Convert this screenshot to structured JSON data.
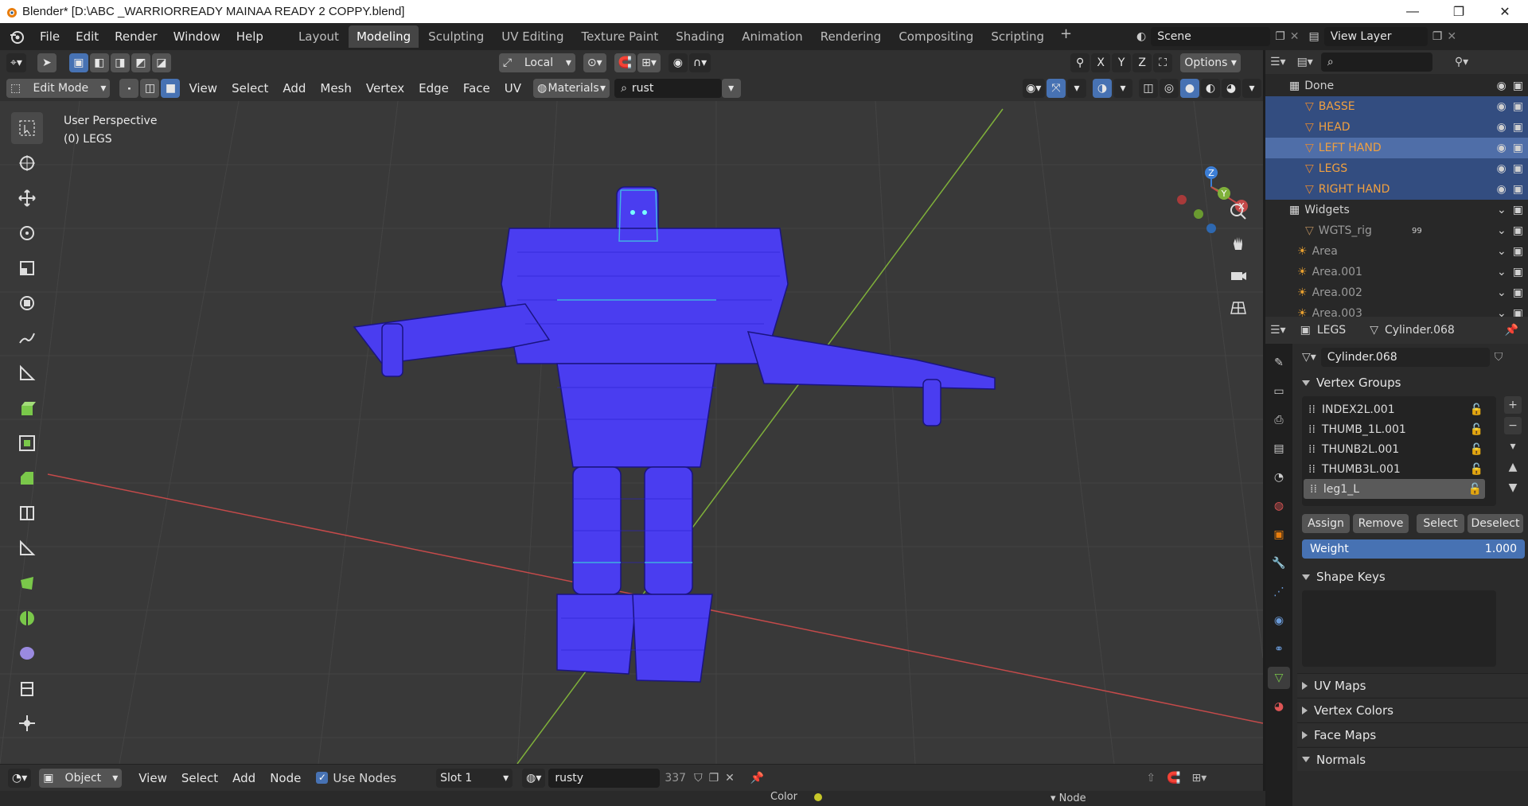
{
  "window": {
    "title": "Blender* [D:\\ABC _WARRIORREADY MAINAA READY 2  COPPY.blend]",
    "min_glyph": "—",
    "max_glyph": "❐",
    "close_glyph": "✕"
  },
  "menu": {
    "items": [
      "File",
      "Edit",
      "Render",
      "Window",
      "Help"
    ]
  },
  "workspaces": {
    "tabs": [
      "Layout",
      "Modeling",
      "Sculpting",
      "UV Editing",
      "Texture Paint",
      "Shading",
      "Animation",
      "Rendering",
      "Compositing",
      "Scripting"
    ],
    "active": "Modeling",
    "add_glyph": "+"
  },
  "scene": {
    "name": "Scene",
    "view_layer": "View Layer"
  },
  "viewport_header": {
    "transform_orientation": "Local",
    "options_label": "Options",
    "axes": [
      "X",
      "Y",
      "Z"
    ],
    "mode": "Edit Mode",
    "menus": [
      "View",
      "Select",
      "Add",
      "Mesh",
      "Vertex",
      "Edge",
      "Face",
      "UV"
    ],
    "materials_label": "Materials",
    "material_filter": "rust"
  },
  "viewport": {
    "perspective": "User Perspective",
    "object_label": "(0) LEGS",
    "gizmo_axes": [
      "Z",
      "Y",
      "X"
    ]
  },
  "bottom_header": {
    "mode": "Object",
    "menus": [
      "View",
      "Select",
      "Add",
      "Node"
    ],
    "use_nodes_label": "Use Nodes",
    "use_nodes_checked": true,
    "slot": "Slot 1",
    "material": "rusty",
    "users": "337",
    "color_label": "Color",
    "node_label": "Node"
  },
  "outliner": {
    "rows": [
      {
        "name": "Done",
        "type": "collection",
        "selected": false
      },
      {
        "name": "BASSE",
        "type": "armature",
        "selected": true
      },
      {
        "name": "HEAD",
        "type": "armature",
        "selected": true
      },
      {
        "name": "LEFT HAND",
        "type": "armature",
        "selected": true,
        "active": true
      },
      {
        "name": "LEGS",
        "type": "armature",
        "selected": true
      },
      {
        "name": "RIGHT HAND",
        "type": "armature",
        "selected": true
      },
      {
        "name": "Widgets",
        "type": "collection",
        "selected": false
      },
      {
        "name": "WGTS_rig",
        "type": "mesh",
        "selected": false,
        "badge": "99"
      },
      {
        "name": "Area",
        "type": "light",
        "selected": false
      },
      {
        "name": "Area.001",
        "type": "light",
        "selected": false
      },
      {
        "name": "Area.002",
        "type": "light",
        "selected": false
      },
      {
        "name": "Area.003",
        "type": "light",
        "selected": false
      }
    ]
  },
  "properties": {
    "object": "LEGS",
    "mesh": "Cylinder.068",
    "mesh_field": "Cylinder.068",
    "vertex_groups_title": "Vertex Groups",
    "vertex_groups": [
      "INDEX2L.001",
      "THUMB_1L.001",
      "THUNB2L.001",
      "THUMB3L.001",
      "leg1_L"
    ],
    "active_group": "leg1_L",
    "buttons": [
      "Assign",
      "Remove",
      "Select",
      "Deselect"
    ],
    "weight_label": "Weight",
    "weight_value": "1.000",
    "shape_keys_title": "Shape Keys",
    "collapsed_panels": [
      "UV Maps",
      "Vertex Colors",
      "Face Maps",
      "Normals"
    ]
  },
  "colors": {
    "accent": "#4772b3",
    "selection": "#334d80",
    "mesh": "#4a3df0",
    "x_axis": "#c44a4a",
    "y_axis": "#7fb03a",
    "z_axis": "#3c7ed6"
  }
}
